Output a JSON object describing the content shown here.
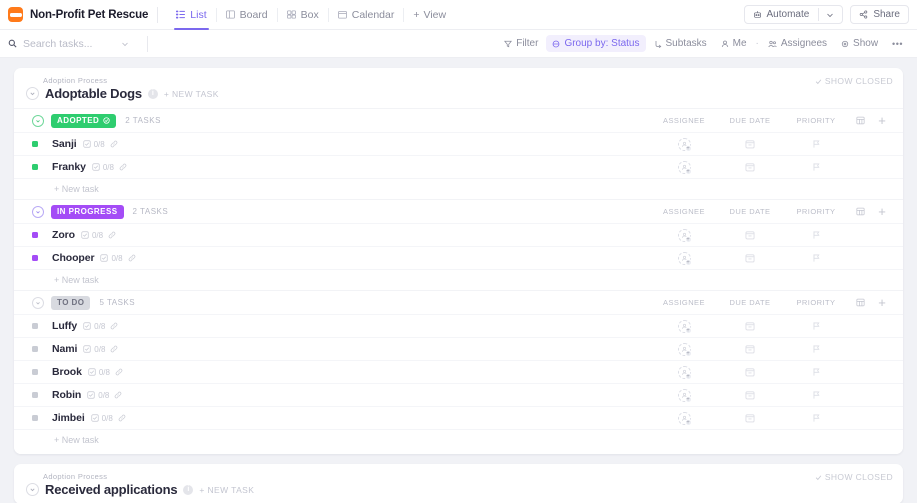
{
  "topbar": {
    "logo_icon": "bone-logo-icon",
    "workspace_title": "Non-Profit Pet Rescue",
    "tabs": [
      {
        "label": "List",
        "icon": "list-icon",
        "active": true
      },
      {
        "label": "Board",
        "icon": "board-icon",
        "active": false
      },
      {
        "label": "Box",
        "icon": "box-icon",
        "active": false
      },
      {
        "label": "Calendar",
        "icon": "calendar-icon",
        "active": false
      }
    ],
    "add_view_label": "View",
    "automate_label": "Automate",
    "share_label": "Share"
  },
  "search": {
    "placeholder": "Search tasks...",
    "icon": "search-icon",
    "chevron_icon": "chevron-down-icon"
  },
  "filters": [
    {
      "label": "Filter",
      "icon": "filter-icon",
      "highlighted": false
    },
    {
      "label": "Group by: Status",
      "icon": "group-icon",
      "highlighted": true
    },
    {
      "label": "Subtasks",
      "icon": "subtasks-icon",
      "highlighted": false
    },
    {
      "label": "Me",
      "icon": "person-icon",
      "highlighted": false
    },
    {
      "label": "Assignees",
      "icon": "assignees-icon",
      "highlighted": false
    },
    {
      "label": "Show",
      "icon": "eye-icon",
      "highlighted": false
    },
    {
      "label": "•••",
      "icon": "more-icon",
      "highlighted": false
    }
  ],
  "columns": {
    "assignee": "ASSIGNEE",
    "due_date": "DUE DATE",
    "priority": "PRIORITY",
    "table_icon": "columns-icon",
    "add_icon": "plus-icon"
  },
  "lists": [
    {
      "breadcrumb": "Adoption Process",
      "name": "Adoptable Dogs",
      "new_task_label": "+ NEW TASK",
      "show_closed_label": "SHOW CLOSED",
      "groups": [
        {
          "status": "ADOPTED",
          "status_color": "#2ecd6f",
          "chevron_class": "green",
          "task_count_label": "2 TASKS",
          "has_check_icon": true,
          "new_task_label": "+ New task",
          "tasks": [
            {
              "name": "Sanji",
              "subtask_count": "0/8",
              "dot_color": "#2ecd6f"
            },
            {
              "name": "Franky",
              "subtask_count": "0/8",
              "dot_color": "#2ecd6f"
            }
          ]
        },
        {
          "status": "IN PROGRESS",
          "status_color": "#a44cf6",
          "chevron_class": "purple",
          "task_count_label": "2 TASKS",
          "has_check_icon": false,
          "new_task_label": "+ New task",
          "tasks": [
            {
              "name": "Zoro",
              "subtask_count": "0/8",
              "dot_color": "#a44cf6"
            },
            {
              "name": "Chooper",
              "subtask_count": "0/8",
              "dot_color": "#a44cf6"
            }
          ]
        },
        {
          "status": "TO DO",
          "status_color": "#d8dae0",
          "chevron_class": "gray",
          "task_count_label": "5 TASKS",
          "has_check_icon": false,
          "new_task_label": "+ New task",
          "tasks": [
            {
              "name": "Luffy",
              "subtask_count": "0/8",
              "dot_color": "#c9ccd4"
            },
            {
              "name": "Nami",
              "subtask_count": "0/8",
              "dot_color": "#c9ccd4"
            },
            {
              "name": "Brook",
              "subtask_count": "0/8",
              "dot_color": "#c9ccd4"
            },
            {
              "name": "Robin",
              "subtask_count": "0/8",
              "dot_color": "#c9ccd4"
            },
            {
              "name": "Jimbei",
              "subtask_count": "0/8",
              "dot_color": "#c9ccd4"
            }
          ]
        }
      ]
    },
    {
      "breadcrumb": "Adoption Process",
      "name": "Received applications",
      "new_task_label": "+ NEW TASK",
      "show_closed_label": "SHOW CLOSED",
      "groups": []
    }
  ],
  "theme": {
    "accent": "#7b68ee",
    "logo_bg": "#ff7a1a",
    "page_bg": "#f1f2f6",
    "card_bg": "#ffffff"
  }
}
